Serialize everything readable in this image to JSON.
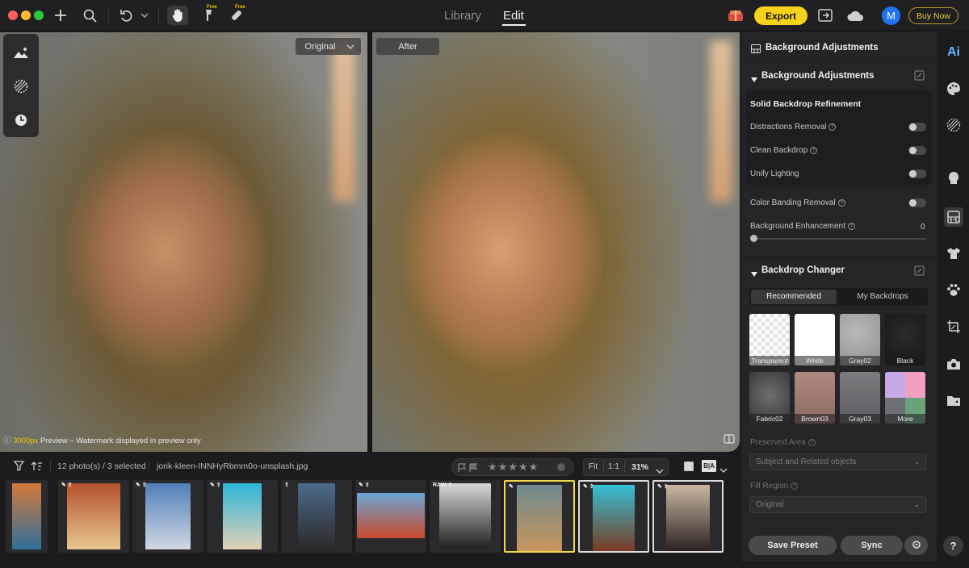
{
  "topbar": {
    "tabs": {
      "library": "Library",
      "edit": "Edit"
    },
    "free_badge_1": "Free",
    "free_badge_2": "Free",
    "export_label": "Export",
    "avatar_initial": "M",
    "buy_now_label": "Buy Now"
  },
  "viewer": {
    "before_label": "Original",
    "after_label": "After",
    "preview_px": "3000px",
    "preview_note": "Preview – Watermark displayed in preview only"
  },
  "filmbar": {
    "count_text": "12 photo(s) / 3 selected",
    "filename": "jorik-kleen-INNHyRbmm0o-unsplash.jpg",
    "fit_label": "Fit",
    "one_to_one_label": "1:1",
    "zoom_value": "31%",
    "rating_stars": 5,
    "ba_label": "B|A"
  },
  "thumbnails": [
    {
      "badge": "",
      "colors": [
        "#d47a3a",
        "#2f6f9a"
      ]
    },
    {
      "badge": "✎ ⇪",
      "colors": [
        "#b5512b",
        "#e7c78e"
      ]
    },
    {
      "badge": "✎ ⇪",
      "colors": [
        "#4f7fb8",
        "#d2d8e2"
      ]
    },
    {
      "badge": "✎ ⇪",
      "colors": [
        "#2fb5d8",
        "#e2d2b6"
      ]
    },
    {
      "badge": "⇪",
      "colors": [
        "#4b6b8a",
        "#2c2a28"
      ]
    },
    {
      "badge": "✎ ⇪",
      "colors": [
        "#6aa6d6",
        "#c7492b"
      ]
    },
    {
      "badge": "RAW ⇪",
      "colors": [
        "#d8d8d8",
        "#222222"
      ]
    },
    {
      "badge": "✎",
      "colors": [
        "#6f8a90",
        "#c8955a"
      ]
    },
    {
      "badge": "✎ ⇪",
      "colors": [
        "#35c1d6",
        "#7a3a22"
      ]
    },
    {
      "badge": "✎ ⇪",
      "colors": [
        "#c9b7a2",
        "#2b2220"
      ]
    }
  ],
  "panel": {
    "header_title": "Background Adjustments",
    "section1_title": "Background Adjustments",
    "sub_title": "Solid Backdrop Refinement",
    "distractions": "Distractions Removal",
    "clean_backdrop": "Clean Backdrop",
    "unify_lighting": "Unify Lighting",
    "color_banding": "Color Banding Removal",
    "bg_enhancement": "Background Enhancement",
    "bg_enhancement_value": "0",
    "section2_title": "Backdrop Changer",
    "tab_recommended": "Recommended",
    "tab_my_backdrops": "My Backdrops",
    "backdrops": [
      "Transparent",
      "White",
      "Gray02",
      "Black",
      "Fabric02",
      "Brown03",
      "Gray03",
      "More"
    ],
    "preserved_area_label": "Preserved Area",
    "preserved_area_value": "Subject and Related objects",
    "fill_region_label": "Fill Region",
    "fill_region_value": "Original",
    "save_preset": "Save Preset",
    "sync": "Sync"
  },
  "rail": {
    "ai_label": "Ai",
    "help_label": "?"
  },
  "colors": {
    "accent_yellow": "#f7d21a",
    "avatar_blue": "#1e74f5",
    "selection_border": "#f0d84c"
  }
}
